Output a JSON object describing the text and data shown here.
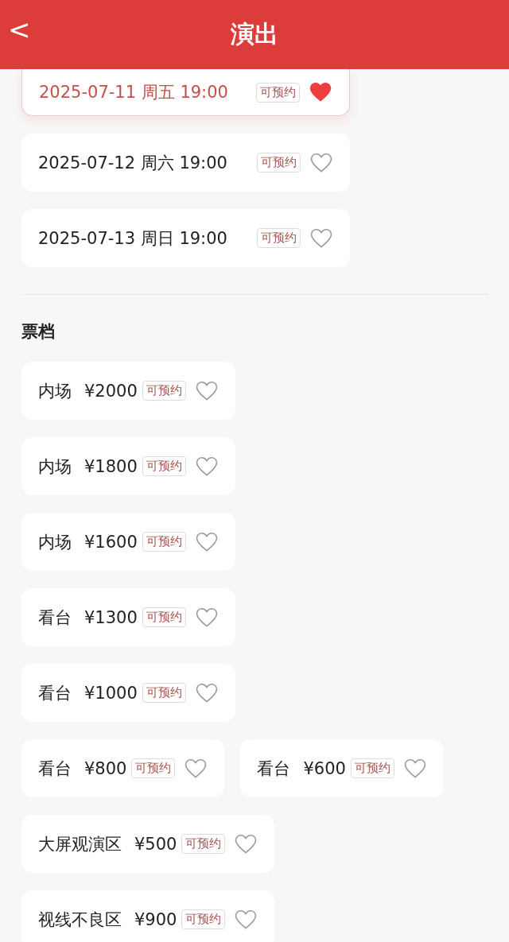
{
  "header": {
    "back": "<",
    "title": "演出"
  },
  "sessions": [
    {
      "label": "2025-07-11 周五 19:00",
      "tag": "可预约",
      "selected": true,
      "favorited": true
    },
    {
      "label": "2025-07-12 周六 19:00",
      "tag": "可预约",
      "selected": false,
      "favorited": false
    },
    {
      "label": "2025-07-13 周日 19:00",
      "tag": "可预约",
      "selected": false,
      "favorited": false
    }
  ],
  "tickets_title": "票档",
  "ticket_rows": [
    [
      {
        "area": "内场",
        "price": "¥2000",
        "tag": "可预约",
        "favorited": false
      }
    ],
    [
      {
        "area": "内场",
        "price": "¥1800",
        "tag": "可预约",
        "favorited": false
      }
    ],
    [
      {
        "area": "内场",
        "price": "¥1600",
        "tag": "可预约",
        "favorited": false
      }
    ],
    [
      {
        "area": "看台",
        "price": "¥1300",
        "tag": "可预约",
        "favorited": false
      }
    ],
    [
      {
        "area": "看台",
        "price": "¥1000",
        "tag": "可预约",
        "favorited": false
      }
    ],
    [
      {
        "area": "看台",
        "price": "¥800",
        "tag": "可预约",
        "favorited": false
      },
      {
        "area": "看台",
        "price": "¥600",
        "tag": "可预约",
        "favorited": false
      }
    ],
    [
      {
        "area": "大屏观演区",
        "price": "¥500",
        "tag": "可预约",
        "favorited": false
      }
    ],
    [
      {
        "area": "视线不良区",
        "price": "¥900",
        "tag": "可预约",
        "favorited": false
      }
    ]
  ]
}
